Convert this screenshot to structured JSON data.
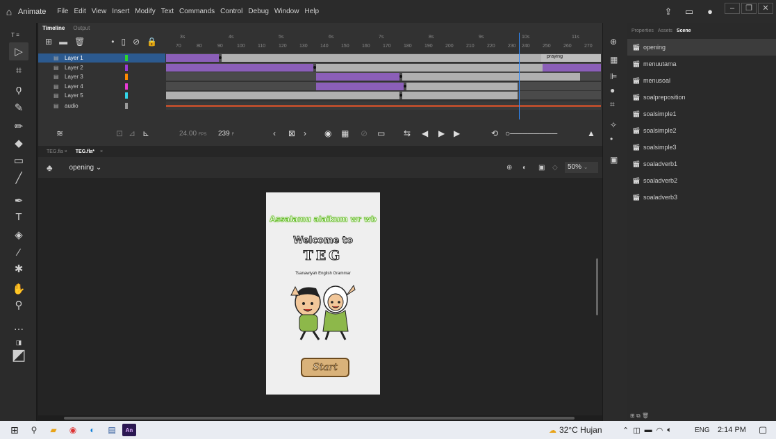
{
  "menubar": {
    "app_name": "Animate",
    "items": [
      "File",
      "Edit",
      "View",
      "Insert",
      "Modify",
      "Text",
      "Commands",
      "Control",
      "Debug",
      "Window",
      "Help"
    ]
  },
  "timeline": {
    "tabs": [
      "Timeline",
      "Output"
    ],
    "ruler_seconds": [
      "3s",
      "4s",
      "5s",
      "6s",
      "7s",
      "8s",
      "9s",
      "10s",
      "11s"
    ],
    "ruler_frames": [
      "70",
      "80",
      "90",
      "100",
      "110",
      "120",
      "130",
      "140",
      "150",
      "160",
      "170",
      "180",
      "190",
      "200",
      "210",
      "220",
      "230",
      "240",
      "250",
      "260",
      "270"
    ],
    "layers": [
      {
        "name": "Layer 1",
        "color": "#2bd62b"
      },
      {
        "name": "Layer 2",
        "color": "#9a3bd6"
      },
      {
        "name": "Layer 3",
        "color": "#ff8a00"
      },
      {
        "name": "Layer 4",
        "color": "#e83bd6"
      },
      {
        "name": "Layer 5",
        "color": "#33d6e8"
      },
      {
        "name": "audio",
        "color": "#9a9a9a"
      }
    ],
    "frame_label": "praying",
    "fps": "24.00",
    "fps_unit": "FPS",
    "current_frame": "239",
    "frame_suffix": "F"
  },
  "doc_tabs": [
    "TEG.fla",
    "TEG.fla*"
  ],
  "scene_bar": {
    "scene_name": "opening",
    "zoom": "50%"
  },
  "stage": {
    "greeting": "Assalamu alaikum wr wb",
    "welcome": "Welcome to",
    "title": "TEG",
    "subtitle": "Tsanawiyah English Grammar",
    "start_button": "Start"
  },
  "panel": {
    "tabs": [
      "Properties",
      "Assets",
      "Scene"
    ],
    "scenes": [
      "opening",
      "menuutama",
      "menusoal",
      "soalpreposition",
      "soalsimple1",
      "soalsimple2",
      "soalsimple3",
      "soaladverb1",
      "soaladverb2",
      "soaladverb3"
    ]
  },
  "taskbar": {
    "weather": "32°C Hujan",
    "language": "ENG",
    "time": "2:14 PM"
  },
  "colors": {
    "selection": "#2c5a8f",
    "playhead": "#2f8bff",
    "tween_purple": "#8b5fb8",
    "stage_green": "#7ed321"
  }
}
